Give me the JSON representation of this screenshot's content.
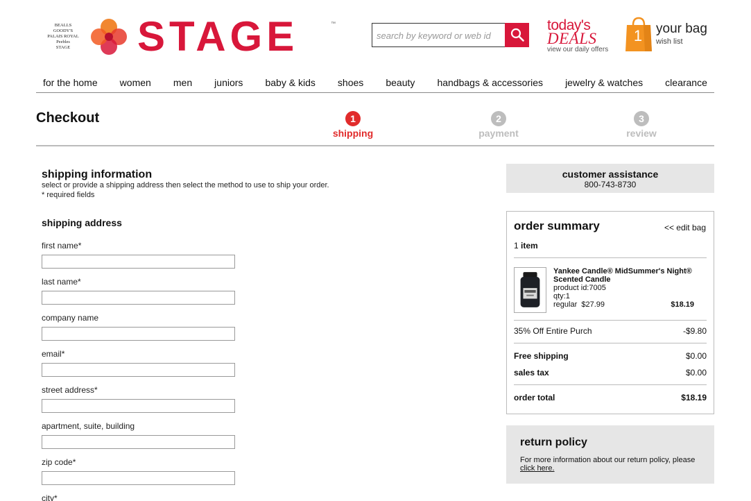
{
  "header": {
    "brands": [
      "BEALLS",
      "GOODY'S",
      "PALAIS ROYAL",
      "Peebles",
      "STAGE"
    ],
    "logo_text": "STAGE",
    "logo_tm": "™",
    "search_placeholder": "search by keyword or web id",
    "deals_line1": "today's",
    "deals_line2": "DEALS",
    "deals_sub": "view our daily offers",
    "bag_count": "1",
    "bag_label": "your bag",
    "wish_label": "wish list",
    "colors": {
      "brand": "#d8173a",
      "bag": "#f39321"
    }
  },
  "nav": [
    "for the home",
    "women",
    "men",
    "juniors",
    "baby & kids",
    "shoes",
    "beauty",
    "handbags & accessories",
    "jewelry & watches",
    "clearance"
  ],
  "checkout": {
    "title": "Checkout",
    "steps": [
      {
        "num": "1",
        "label": "shipping",
        "state": "active"
      },
      {
        "num": "2",
        "label": "payment",
        "state": "inactive"
      },
      {
        "num": "3",
        "label": "review",
        "state": "inactive"
      }
    ]
  },
  "shipping": {
    "heading": "shipping information",
    "description": "select or provide a shipping address then select the method to use to ship your order.",
    "required_note": "* required fields",
    "address_heading": "shipping address",
    "fields": [
      {
        "label": "first name",
        "req": "*",
        "value": ""
      },
      {
        "label": "last name",
        "req": "*",
        "value": ""
      },
      {
        "label": "company name",
        "req": "",
        "value": ""
      },
      {
        "label": "email",
        "req": "*",
        "value": ""
      },
      {
        "label": "street address",
        "req": "*",
        "value": ""
      },
      {
        "label": "apartment, suite, building",
        "req": "",
        "value": ""
      },
      {
        "label": "zip code",
        "req": "*",
        "value": ""
      },
      {
        "label": "city",
        "req": "*",
        "value": ""
      }
    ]
  },
  "assistance": {
    "title": "customer assistance",
    "phone": "800-743-8730"
  },
  "summary": {
    "title": "order summary",
    "edit_bag": "<< edit bag",
    "item_count_num": "1",
    "item_count_word": "item",
    "product": {
      "name": "Yankee Candle® MidSummer's Night® Scented Candle",
      "product_id": "product id:7005",
      "qty": "qty:1",
      "regular": "regular  $27.99",
      "price": "$18.19"
    },
    "discount": {
      "label": "35% Off Entire Purch",
      "value": "-$9.80"
    },
    "shipping": {
      "label": "Free shipping",
      "value": "$0.00"
    },
    "tax": {
      "label": "sales tax",
      "value": "$0.00"
    },
    "total": {
      "label": "order total",
      "value": "$18.19"
    }
  },
  "policy": {
    "title": "return policy",
    "text": "For more information about our return policy, please",
    "link": "click here."
  }
}
